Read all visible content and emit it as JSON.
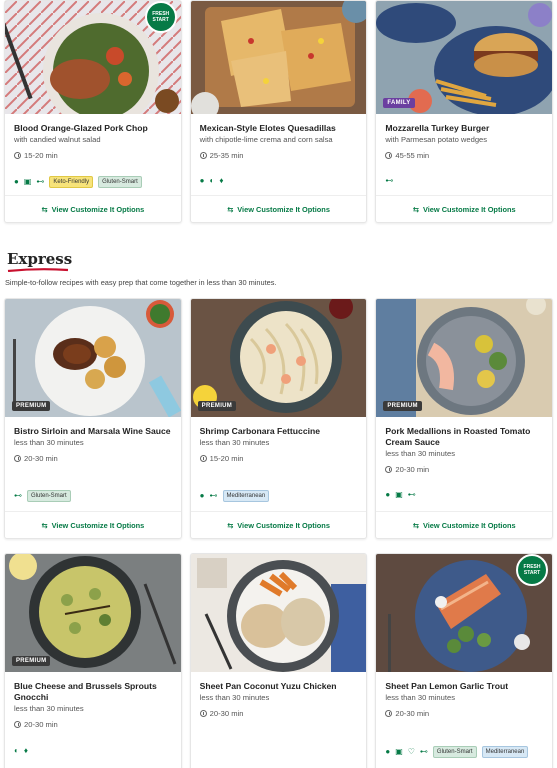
{
  "row1": [
    {
      "title": "Blood Orange-Glazed Pork Chop",
      "sub": "with candied walnut salad",
      "time": "15-20 min",
      "badge": "",
      "fresh": "FRESH START",
      "tags": [
        "Keto-Friendly",
        "Gluten-Smart"
      ],
      "icons": [
        "apple-icon",
        "leaf-icon",
        "dumbbell-icon"
      ],
      "cta": "View Customize It Options"
    },
    {
      "title": "Mexican-Style Elotes Quesadillas",
      "sub": "with chipotle-lime crema and corn salsa",
      "time": "25-35 min",
      "badge": "",
      "fresh": "",
      "tags": [],
      "icons": [
        "apple-icon",
        "pepper-icon",
        "leaf-icon"
      ],
      "cta": "View Customize It Options"
    },
    {
      "title": "Mozzarella Turkey Burger",
      "sub": "with Parmesan potato wedges",
      "time": "45-55 min",
      "badge": "FAMILY",
      "fresh": "",
      "tags": [],
      "icons": [
        "dumbbell-icon"
      ],
      "cta": "View Customize It Options"
    }
  ],
  "section": {
    "title": "Express",
    "description": "Simple-to-follow recipes with easy prep that come together in less than 30 minutes."
  },
  "row2": [
    {
      "title": "Bistro Sirloin and Marsala Wine Sauce",
      "sub": "less than 30 minutes",
      "time": "20-30 min",
      "badge": "PREMIUM",
      "fresh": "",
      "tags": [
        "Gluten-Smart"
      ],
      "icons": [
        "dumbbell-icon"
      ],
      "cta": "View Customize It Options"
    },
    {
      "title": "Shrimp Carbonara Fettuccine",
      "sub": "less than 30 minutes",
      "time": "15-20 min",
      "badge": "PREMIUM",
      "fresh": "",
      "tags": [
        "Mediterranean"
      ],
      "icons": [
        "apple-icon",
        "dumbbell-icon"
      ],
      "cta": "View Customize It Options"
    },
    {
      "title": "Pork Medallions in Roasted Tomato Cream Sauce",
      "sub": "less than 30 minutes",
      "time": "20-30 min",
      "badge": "PREMIUM",
      "fresh": "",
      "tags": [],
      "icons": [
        "apple-icon",
        "scale-icon",
        "dumbbell-icon"
      ],
      "cta": "View Customize It Options"
    }
  ],
  "row3": [
    {
      "title": "Blue Cheese and Brussels Sprouts Gnocchi",
      "sub": "less than 30 minutes",
      "time": "20-30 min",
      "badge": "PREMIUM",
      "fresh": "",
      "tags": [],
      "icons": [
        "pepper-icon",
        "leaf-icon"
      ]
    },
    {
      "title": "Sheet Pan Coconut Yuzu Chicken",
      "sub": "less than 30 minutes",
      "time": "20-30 min",
      "badge": "",
      "fresh": "",
      "tags": [],
      "icons": []
    },
    {
      "title": "Sheet Pan Lemon Garlic Trout",
      "sub": "less than 30 minutes",
      "time": "20-30 min",
      "badge": "",
      "fresh": "FRESH START",
      "tags": [
        "Gluten-Smart",
        "Mediterranean"
      ],
      "icons": [
        "apple-icon",
        "scale-icon",
        "heart-icon",
        "dumbbell-icon"
      ]
    }
  ],
  "colors": {
    "accent": "#067a46",
    "underline": "#c8102e",
    "keto": "#f7e37a",
    "glutensmart": "#d7eadf",
    "mediterranean": "#d7e8f5"
  }
}
